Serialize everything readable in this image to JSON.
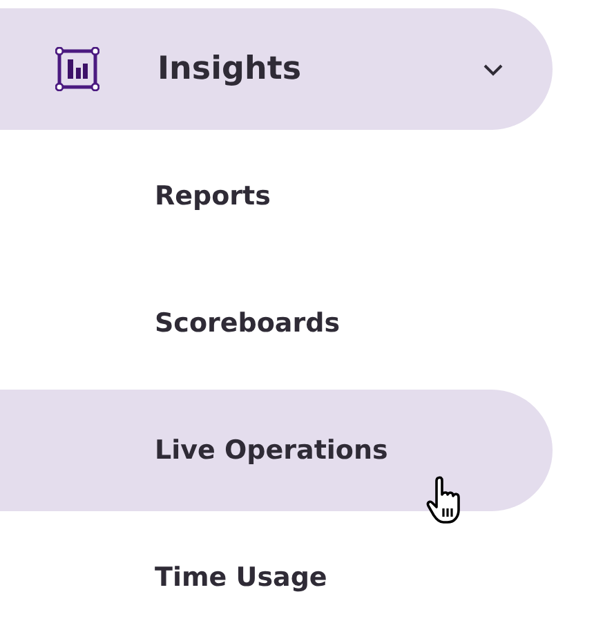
{
  "nav_group": {
    "label": "Insights",
    "expanded": true,
    "items": [
      {
        "label": "Reports",
        "selected": false
      },
      {
        "label": "Scoreboards",
        "selected": false
      },
      {
        "label": "Live Operations",
        "selected": true
      },
      {
        "label": "Time Usage",
        "selected": false
      }
    ]
  }
}
